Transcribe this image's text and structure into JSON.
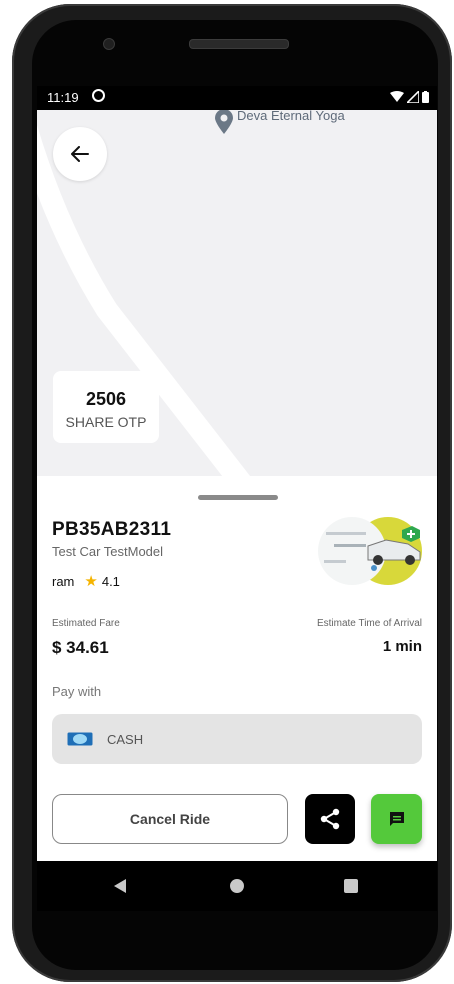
{
  "status_bar": {
    "time": "11:19"
  },
  "map": {
    "poi_label": "Deva Eternal Yoga",
    "otp_code": "2506",
    "otp_label": "SHARE OTP"
  },
  "ride": {
    "plate": "PB35AB2311",
    "car_model": "Test Car TestModel",
    "driver_name": "ram",
    "rating": "4.1",
    "estimated_fare_label": "Estimated Fare",
    "estimated_fare": "$ 34.61",
    "eta_label": "Estimate Time of Arrival",
    "eta": "1 min",
    "pay_with_label": "Pay with",
    "payment_method": "CASH"
  },
  "actions": {
    "cancel_label": "Cancel Ride"
  },
  "colors": {
    "accent_green": "#54c93b",
    "star": "#f5b400",
    "map_bg": "#f1f1f3"
  }
}
